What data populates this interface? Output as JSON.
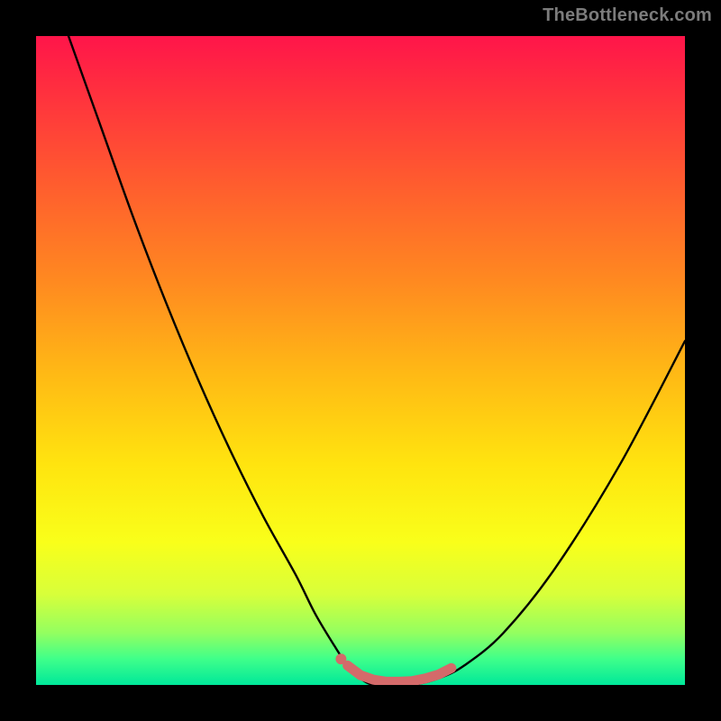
{
  "watermark": "TheBottleneck.com",
  "colors": {
    "frame": "#000000",
    "gradient_top": "#ff154a",
    "gradient_bottom": "#00e89a",
    "curve_stroke": "#000000",
    "marker_stroke": "#d46a6a",
    "marker_fill": "#d46a6a"
  },
  "chart_data": {
    "type": "line",
    "title": "",
    "xlabel": "",
    "ylabel": "",
    "xlim": [
      0,
      100
    ],
    "ylim": [
      0,
      100
    ],
    "grid": false,
    "series": [
      {
        "name": "bottleneck-curve",
        "x": [
          5,
          10,
          15,
          20,
          25,
          30,
          35,
          40,
          43,
          46,
          48,
          50,
          52,
          55,
          58,
          62,
          66,
          72,
          80,
          90,
          100
        ],
        "y": [
          100,
          86,
          72,
          59,
          47,
          36,
          26,
          17,
          11,
          6,
          3,
          1,
          0,
          0,
          0,
          1,
          3,
          8,
          18,
          34,
          53
        ]
      }
    ],
    "markers": {
      "name": "highlight-band",
      "x": [
        48,
        50,
        52,
        54,
        56,
        58,
        60,
        62,
        64
      ],
      "y": [
        3,
        1.5,
        0.8,
        0.5,
        0.5,
        0.6,
        1.0,
        1.6,
        2.6
      ]
    },
    "marker_dot": {
      "x": 47,
      "y": 4
    }
  }
}
